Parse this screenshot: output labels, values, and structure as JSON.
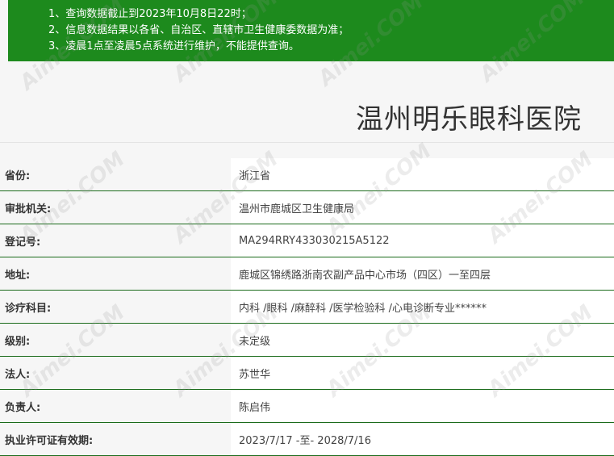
{
  "notice": {
    "lines": [
      "1、查询数据截止到2023年10月8日22时；",
      "2、信息数据结果以各省、自治区、直辖市卫生健康委数据为准；",
      "3、凌晨1点至凌晨5点系统进行维护，不能提供查询。"
    ]
  },
  "hospital_name": "温州明乐眼科医院",
  "rows": [
    {
      "label": "省份:",
      "value": "浙江省"
    },
    {
      "label": "审批机关:",
      "value": "温州市鹿城区卫生健康局"
    },
    {
      "label": "登记号:",
      "value": "MA294RRY433030215A5122"
    },
    {
      "label": "地址:",
      "value": "鹿城区锦绣路浙南农副产品中心市场（四区）一至四层"
    },
    {
      "label": "诊疗科目:",
      "value": "内科 /眼科 /麻醉科 /医学检验科 /心电诊断专业******"
    },
    {
      "label": "级别:",
      "value": "未定级"
    },
    {
      "label": "法人:",
      "value": "苏世华"
    },
    {
      "label": "负责人:",
      "value": "陈启伟"
    },
    {
      "label": "执业许可证有效期:",
      "value": "2023/7/17 -至- 2028/7/16"
    }
  ],
  "watermark": "Aimei.COM"
}
